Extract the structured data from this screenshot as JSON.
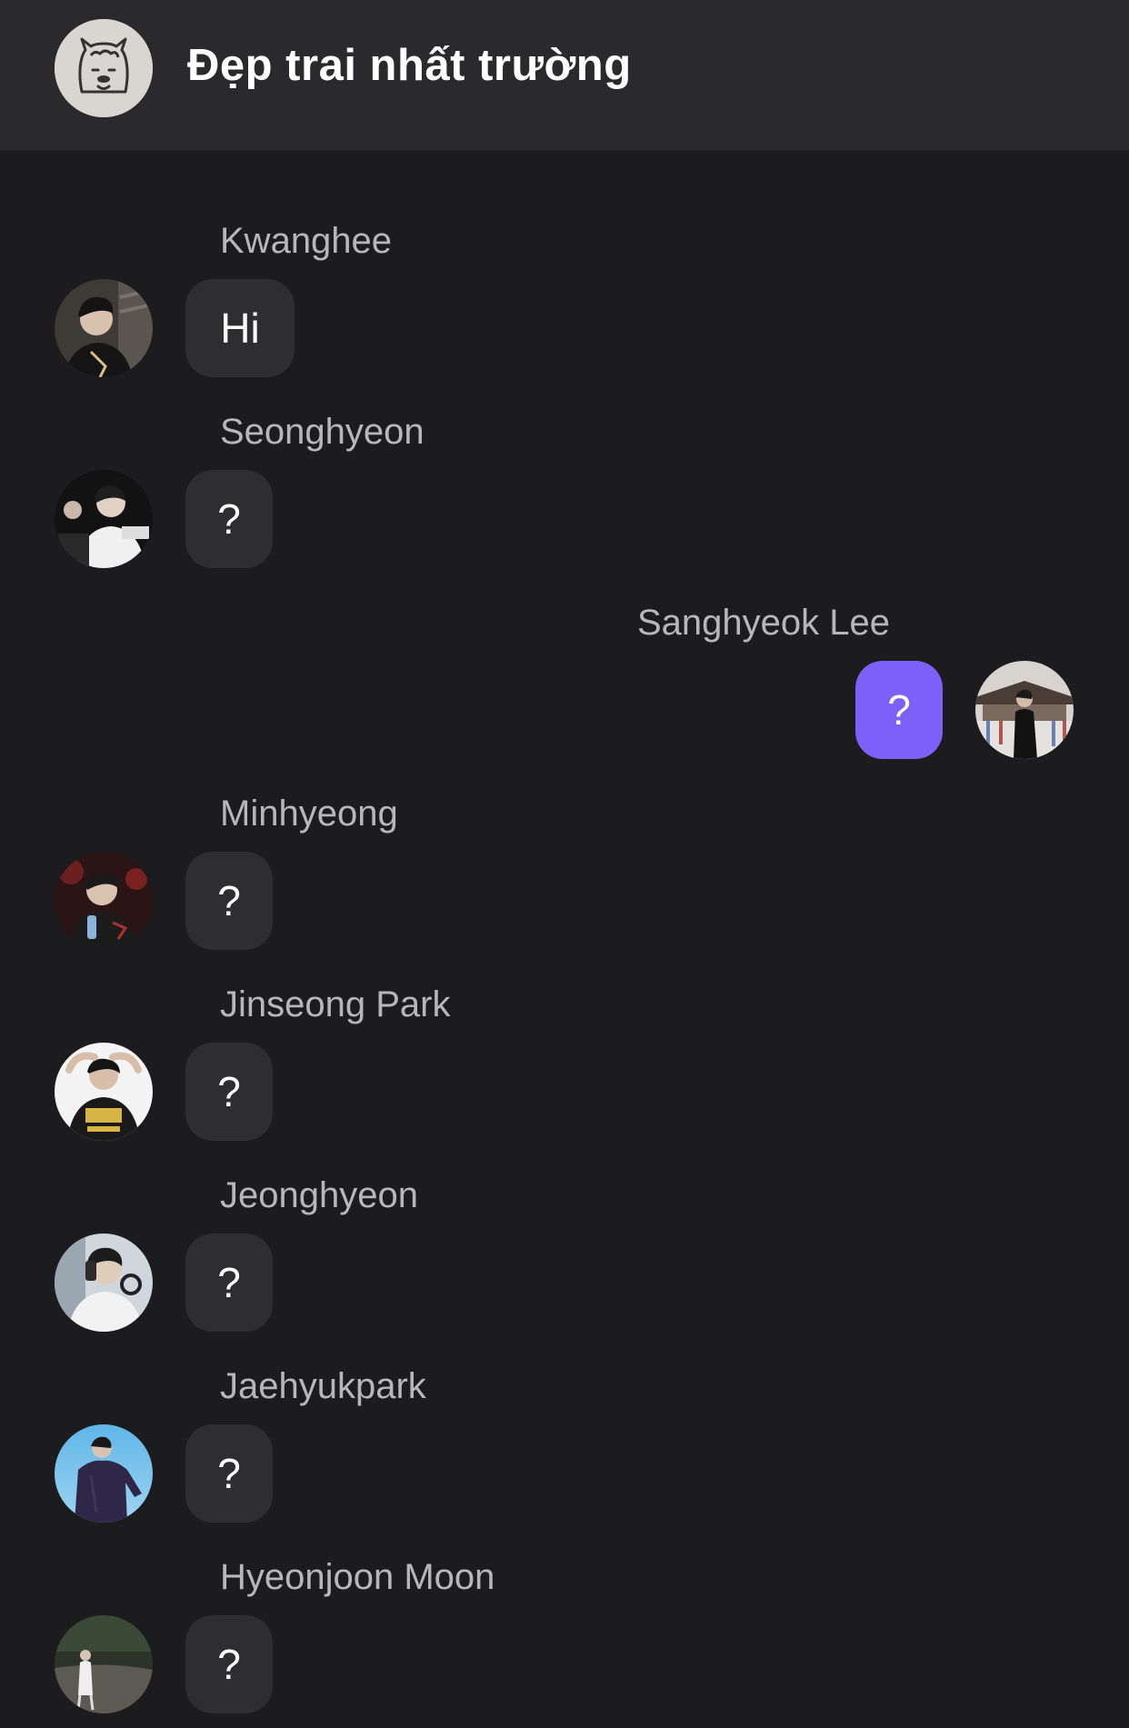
{
  "header": {
    "title": "Đẹp trai nhất trường",
    "avatar_icon": "llama-face-icon"
  },
  "messages": [
    {
      "sender": "Kwanghee",
      "text": "Hi",
      "mine": false
    },
    {
      "sender": "Seonghyeon",
      "text": "?",
      "mine": false
    },
    {
      "sender": "Sanghyeok Lee",
      "text": "?",
      "mine": true
    },
    {
      "sender": "Minhyeong",
      "text": "?",
      "mine": false
    },
    {
      "sender": "Jinseong Park",
      "text": "?",
      "mine": false
    },
    {
      "sender": "Jeonghyeon",
      "text": "?",
      "mine": false
    },
    {
      "sender": "Jaehyukpark",
      "text": "?",
      "mine": false
    },
    {
      "sender": "Hyeonjoon Moon",
      "text": "?",
      "mine": false
    }
  ],
  "colors": {
    "background": "#1c1c1e",
    "header": "#2a2a2c",
    "incoming_bubble": "#2e2e31",
    "outgoing_bubble": "#7b61f8",
    "sender_name": "#b7b7bb"
  }
}
